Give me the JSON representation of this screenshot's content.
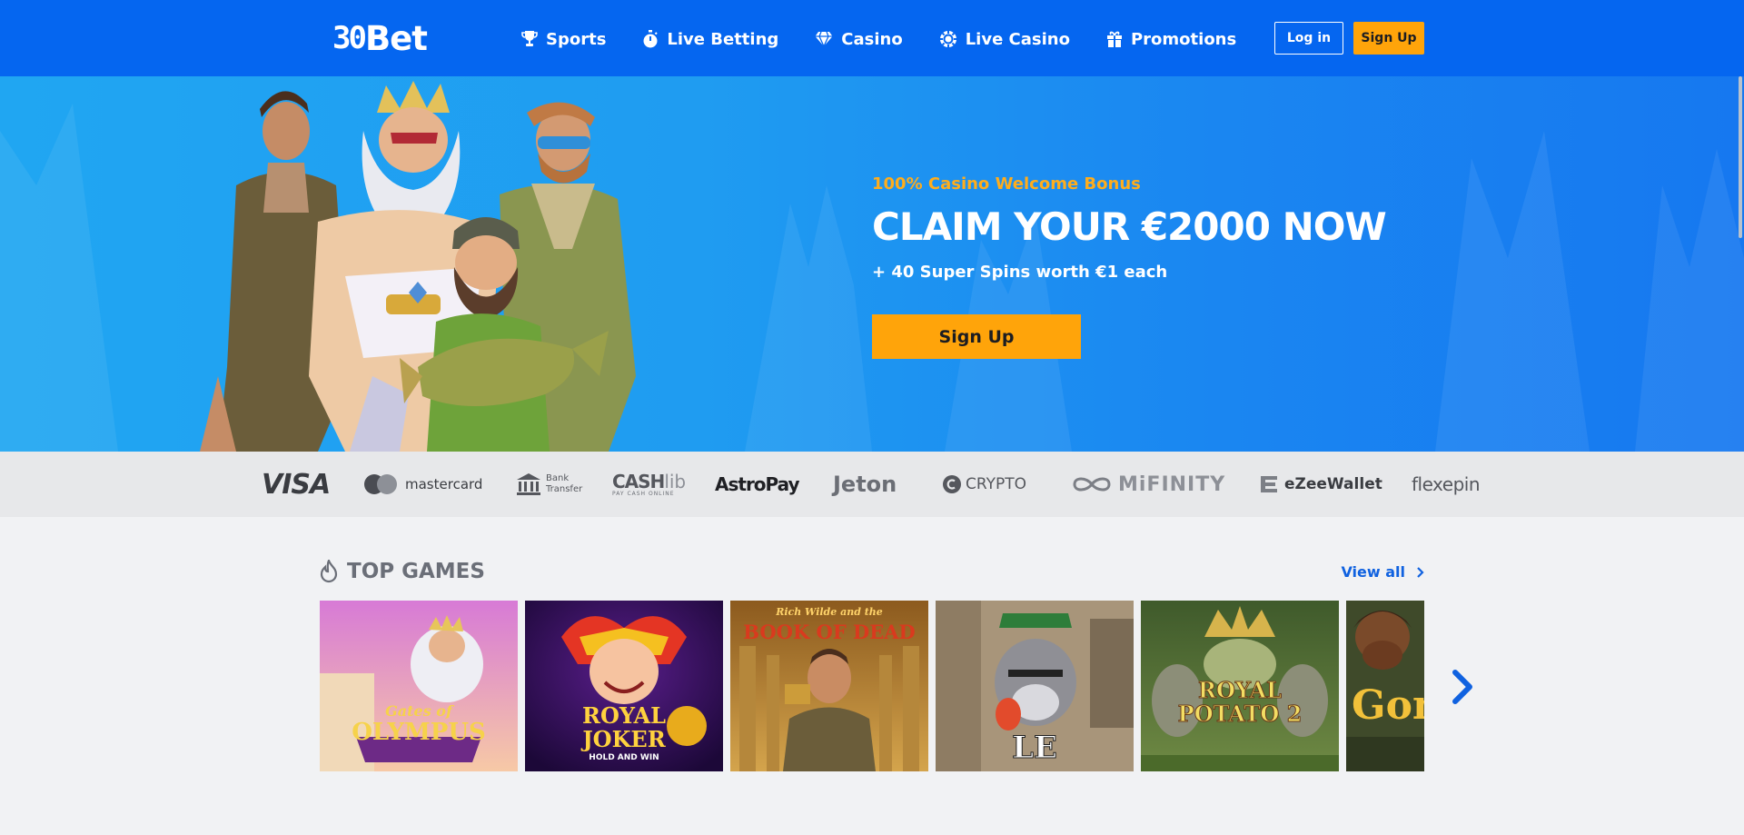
{
  "header": {
    "logo": {
      "num": "30",
      "word": "Bet"
    },
    "nav": [
      {
        "label": "Sports",
        "icon": "trophy-icon"
      },
      {
        "label": "Live Betting",
        "icon": "stopwatch-icon"
      },
      {
        "label": "Casino",
        "icon": "diamond-icon"
      },
      {
        "label": "Live Casino",
        "icon": "casino-chip-icon"
      },
      {
        "label": "Promotions",
        "icon": "gift-icon"
      }
    ],
    "login_label": "Log in",
    "signup_label": "Sign Up"
  },
  "hero": {
    "kicker": "100% Casino Welcome Bonus",
    "title": "CLAIM YOUR €2000 NOW",
    "subtitle": "+ 40 Super Spins worth €1 each",
    "cta_label": "Sign Up"
  },
  "payments": {
    "visa": "VISA",
    "mastercard": "mastercard",
    "bank_line1": "Bank",
    "bank_line2": "Transfer",
    "cashlib": "CASH",
    "cashlib_suffix": "lib",
    "cashlib_tag": "PAY CASH ONLINE",
    "astropay": "AstroPay",
    "jeton": "Jeton",
    "crypto": "CRYPTO",
    "mifinity": "MiFINITY",
    "ezeewallet": "eZeeWallet",
    "flexepin": "flexepin"
  },
  "top_games": {
    "title": "TOP GAMES",
    "view_all": "View all",
    "games": [
      {
        "line1": "Gates of",
        "line2": "OLYMPUS"
      },
      {
        "line1": "ROYAL",
        "line2": "JOKER",
        "line3": "HOLD AND WIN"
      },
      {
        "line1": "Rich Wilde and the",
        "line2": "BOOK OF DEAD"
      },
      {
        "line1": "LE BANDIT"
      },
      {
        "line1": "ROYAL",
        "line2": "POTATO 2"
      },
      {
        "line1": "Gon"
      }
    ]
  },
  "colors": {
    "header_bg": "#0566f0",
    "accent": "#ffa40a",
    "kicker": "#ffad1c",
    "link": "#1062e0"
  }
}
